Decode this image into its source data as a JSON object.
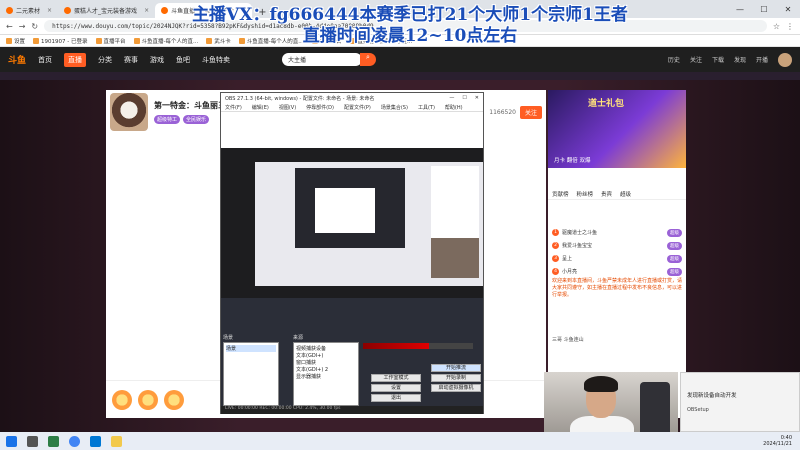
{
  "browser": {
    "tabs": [
      {
        "label": "二元素材"
      },
      {
        "label": "蛋糕人才_宝元装备游戏"
      },
      {
        "label": "斗鱼直播_斗鱼直播平台"
      }
    ],
    "url": "https://www.douyu.com/topic/2024NJQK?rid=5358?B92pKF&dyshid=d1ac8db-e00b-4d4e0aa70008b0d9",
    "bookmarks": [
      "设置",
      "1901907 - 已登录",
      "直播平台",
      "斗鱼直播-每个人的直...",
      "武斗卡",
      "斗鱼直播-每个人的直...",
      "未来平台",
      "直播器 - 蛋糕人才宝..."
    ]
  },
  "site": {
    "logo": "斗鱼",
    "nav": [
      "首页",
      "直播",
      "分类",
      "赛事",
      "游戏",
      "鱼吧",
      "斗鱼特卖"
    ],
    "active_nav": "直播",
    "search_placeholder": "大主播",
    "header_icons": [
      "历史",
      "关注",
      "下载",
      "发现",
      "开播"
    ]
  },
  "room": {
    "title": "第一特金：斗鱼丽三...",
    "badges": [
      "超级特工",
      "全民娱乐"
    ],
    "follow_label": "关注",
    "follower_count": "1166520"
  },
  "obs": {
    "title": "OBS 27.1.3 (64-bit, windows) - 配置文件: 未命名 - 场景: 未命名",
    "menu": [
      "文件(F)",
      "编辑(E)",
      "视图(V)",
      "停靠部件(D)",
      "配置文件(P)",
      "场景集合(S)",
      "工具(T)",
      "帮助(H)"
    ],
    "scenes_label": "场景",
    "scene_item": "场景",
    "sources_label": "来源",
    "sources": [
      "视频捕获设备",
      "文本(GDI+)",
      "窗口捕获",
      "文本(GDI+) 2",
      "显示器捕获"
    ],
    "buttons": [
      "开始推流",
      "开始录制",
      "启动虚拟摄像机",
      "工作室模式",
      "设置",
      "退出"
    ],
    "status": "LIVE: 00:00:00  REC: 00:00:00  CPU: 2.4%, 30.00 fps"
  },
  "side": {
    "promo_title": "道士礼包",
    "promo_sub": "月卡 翻倍 双爆",
    "tabs": [
      "贡献榜",
      "粉丝榜",
      "贵宾",
      "超级"
    ],
    "ranks": [
      {
        "num": "1",
        "name": "驱魔道士之斗鱼",
        "tag": "超级"
      },
      {
        "num": "2",
        "name": "我爱斗鱼宝宝",
        "tag": "超级"
      },
      {
        "num": "3",
        "name": "呈上",
        "tag": "超级"
      },
      {
        "num": "4",
        "name": "小月亮",
        "tag": "超级"
      }
    ],
    "notice": "欢迎来到本直播间，斗鱼严禁未成年人进行直播或打赏，请大家共同遵守，如主播在直播过程中发布不良信息，可以进行举报。",
    "chat": "三哥 斗鱼连山"
  },
  "notification": {
    "title": "发现新设备自动开发",
    "app": "OBSetup"
  },
  "taskbar": {
    "time": "0:40",
    "date": "2024/11/21"
  },
  "overlay": {
    "line1": "主播VX：fg666444本赛季已打21个大师1个宗师1王者",
    "line2": "直播时间凌晨12~10点左右"
  }
}
